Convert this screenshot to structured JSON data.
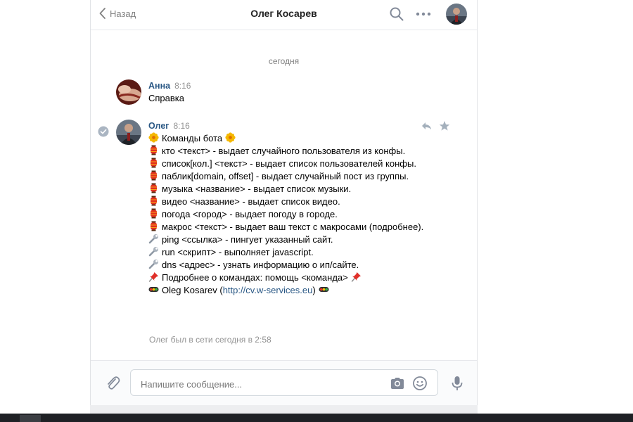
{
  "header": {
    "back_label": "Назад",
    "title": "Олег Косарев"
  },
  "date_separator": "сегодня",
  "messages": [
    {
      "author": "Анна",
      "time": "8:16",
      "lines": [
        "Справка"
      ]
    },
    {
      "author": "Олег",
      "time": "8:16",
      "lines": [
        {
          "icon": "flower",
          "text": "Команды бота",
          "icon_after": "flower"
        },
        {
          "icon": "lantern",
          "text": "кто <текст> - выдает случайного пользователя из конфы."
        },
        {
          "icon": "lantern",
          "text": "список[кол.] <текст> - выдает список пользователей конфы."
        },
        {
          "icon": "lantern",
          "text": "паблик[domain, offset] - выдает случайный пост из группы."
        },
        {
          "icon": "lantern",
          "text": "музыка <название> - выдает список музыки."
        },
        {
          "icon": "lantern",
          "text": "видео <название> - выдает список видео."
        },
        {
          "icon": "lantern",
          "text": "погода <город> - выдает погоду в городе."
        },
        {
          "icon": "lantern",
          "text": "макрос <текст> - выдает ваш текст с макросами (подробнее)."
        },
        {
          "icon": "wrench",
          "text": "ping <ссылка> - пингует указанный сайт."
        },
        {
          "icon": "wrench",
          "text": "run <скрипт> - выполняет javascript."
        },
        {
          "icon": "wrench",
          "text": "dns <адрес> - узнать информацию о ип/сайте."
        },
        {
          "icon": "pushpin",
          "text": "Подробнее о командах: помощь <команда>",
          "icon_after": "pushpin"
        }
      ],
      "signature": {
        "icon": "traffic-light",
        "name": "Oleg Kosarev (",
        "link": "http://cv.w-services.eu",
        "close": ")"
      }
    }
  ],
  "status_text": "Олег был в сети сегодня в 2:58",
  "composer": {
    "placeholder": "Напишите сообщение..."
  },
  "colors": {
    "accent": "#2a5885",
    "background": "#edeef0",
    "panel": "#ffffff"
  },
  "icons": [
    "chevron-left-icon",
    "search-icon",
    "more-icon",
    "check-circle-icon",
    "reply-icon",
    "star-icon",
    "attach-icon",
    "camera-icon",
    "smile-icon",
    "mic-icon"
  ]
}
